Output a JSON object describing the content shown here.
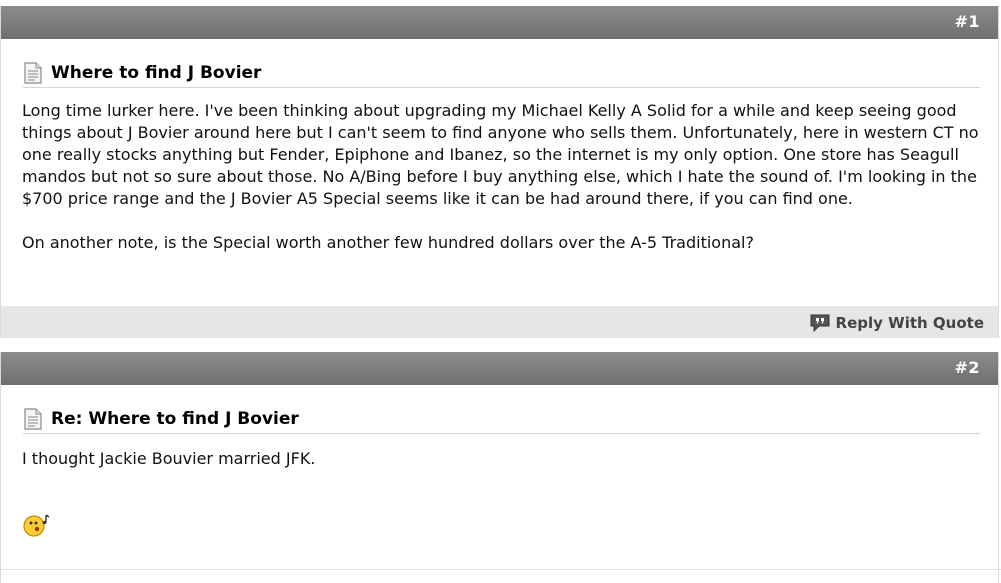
{
  "posts": [
    {
      "number": "#1",
      "title": "Where to find J Bovier",
      "paragraphs": [
        "Long time lurker here. I've been thinking about upgrading my Michael Kelly A Solid for a while and keep seeing good things about J Bovier around here but I can't seem to find anyone who sells them. Unfortunately, here in western CT no one really stocks anything but Fender, Epiphone and Ibanez, so the internet is my only option. One store has Seagull mandos but not so sure about those. No A/Bing before I buy anything else, which I hate the sound of. I'm looking in the $700 price range and the J Bovier A5 Special seems like it can be had around there, if you can find one.",
        "On another note, is the Special worth another few hundred dollars over the A-5 Traditional?"
      ],
      "reply_label": "Reply With Quote"
    },
    {
      "number": "#2",
      "title": "Re: Where to find J Bovier",
      "paragraphs": [
        "I thought Jackie Bouvier married JFK."
      ],
      "smiley_icon": "whistle-smiley-icon"
    }
  ],
  "colors": {
    "header_bar": "#7a7a7a",
    "footer_bar": "#e6e6e6",
    "post_number": "#ffffff",
    "reply_text": "#444444"
  }
}
